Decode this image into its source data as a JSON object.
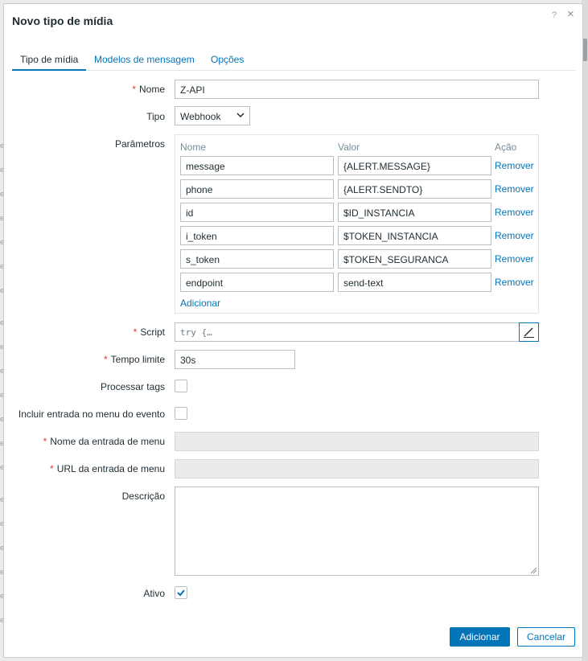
{
  "dialog": {
    "title": "Novo tipo de mídia",
    "help_icon": "?",
    "close_icon": "×"
  },
  "tabs": [
    {
      "label": "Tipo de mídia",
      "active": true
    },
    {
      "label": "Modelos de mensagem",
      "active": false
    },
    {
      "label": "Opções",
      "active": false
    }
  ],
  "form": {
    "name": {
      "label": "Nome",
      "required_mark": "*",
      "value": "Z-API"
    },
    "type": {
      "label": "Tipo",
      "value": "Webhook"
    },
    "parameters": {
      "label": "Parâmetros",
      "col_name": "Nome",
      "col_value": "Valor",
      "col_action": "Ação",
      "remove_label": "Remover",
      "add_label": "Adicionar",
      "rows": [
        {
          "name": "message",
          "value": "{ALERT.MESSAGE}"
        },
        {
          "name": "phone",
          "value": "{ALERT.SENDTO}"
        },
        {
          "name": "id",
          "value": "$ID_INSTANCIA"
        },
        {
          "name": "i_token",
          "value": "$TOKEN_INSTANCIA"
        },
        {
          "name": "s_token",
          "value": "$TOKEN_SEGURANCA"
        },
        {
          "name": "endpoint",
          "value": "send-text"
        }
      ]
    },
    "script": {
      "label": "Script",
      "required_mark": "*",
      "value": "try {…"
    },
    "timeout": {
      "label": "Tempo limite",
      "required_mark": "*",
      "value": "30s"
    },
    "process_tags": {
      "label": "Processar tags",
      "checked": false
    },
    "event_menu": {
      "label": "Incluir entrada no menu do evento",
      "checked": false
    },
    "menu_entry_name": {
      "label": "Nome da entrada de menu",
      "required_mark": "*",
      "value": ""
    },
    "menu_entry_url": {
      "label": "URL da entrada de menu",
      "required_mark": "*",
      "value": ""
    },
    "description": {
      "label": "Descrição",
      "value": ""
    },
    "enabled": {
      "label": "Ativo",
      "checked": true
    }
  },
  "footer": {
    "add_label": "Adicionar",
    "cancel_label": "Cancelar"
  },
  "colors": {
    "accent": "#0275b8",
    "required": "#e33734",
    "text": "#1f2c33"
  },
  "icons": {
    "script_edit": "pencil-icon",
    "select_arrow": "chevron-down-icon",
    "checkbox_check": "check-icon"
  }
}
